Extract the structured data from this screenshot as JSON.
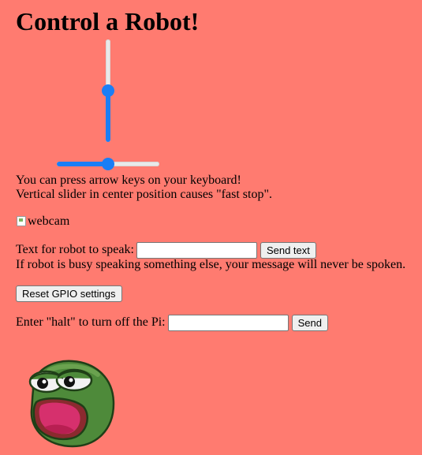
{
  "page": {
    "title": "Control a Robot!",
    "background_color": "#ff7b70"
  },
  "controls": {
    "vertical_slider": {
      "value_fraction": 0.5,
      "accent_color": "#1a7ef5"
    },
    "horizontal_slider": {
      "value_fraction": 0.5,
      "accent_color": "#1a7ef5"
    }
  },
  "help": {
    "line1": "You can press arrow keys on your keyboard!",
    "line2": "Vertical slider in center position causes \"fast stop\"."
  },
  "webcam": {
    "alt_text": "webcam",
    "icon": "broken-image-icon"
  },
  "speak": {
    "label": "Text for robot to speak:",
    "input_value": "",
    "button_label": "Send text",
    "note": "If robot is busy speaking something else, your message will never be spoken."
  },
  "reset": {
    "button_label": "Reset GPIO settings"
  },
  "halt": {
    "label": "Enter \"halt\" to turn off the Pi:",
    "input_value": "",
    "button_label": "Send"
  },
  "mascot": {
    "icon": "frog-face-icon"
  }
}
